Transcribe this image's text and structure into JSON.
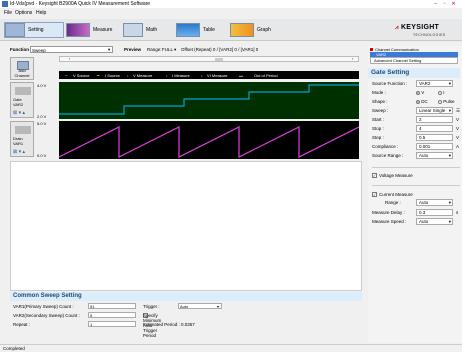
{
  "window": {
    "title": "Id-Vds(pvd - Keysight B2900A Quick IV Measurement Software"
  },
  "menu": {
    "items": [
      "File",
      "Options",
      "Help"
    ]
  },
  "toolbar": {
    "buttons": [
      {
        "label": "Setting",
        "active": true
      },
      {
        "label": "Measure",
        "active": false
      },
      {
        "label": "Math",
        "active": false
      },
      {
        "label": "Table",
        "active": false
      },
      {
        "label": "Graph",
        "active": false
      }
    ],
    "logo": "KEYSIGHT",
    "logo_sub": "TECHNOLOGIES"
  },
  "function_bar": {
    "function_label": "Function",
    "function_value": "Sweep",
    "preview_label": "Preview",
    "range_label": "Range:",
    "range_value": "FULL",
    "offset_text": "Offset (Repeat) 0 / [VAR2] 0 / [VAR1] 0"
  },
  "left": {
    "add_channel": "Add Channel"
  },
  "legend": {
    "items": [
      "V Source",
      "I Source",
      "V Measure",
      "I Measure",
      "VI Measure",
      "Out of Period"
    ],
    "colors": [
      "#00a0d8",
      "#e8e800",
      "#aaaaaa",
      "#aaaaaa",
      "#aaaaaa",
      "#ffffff"
    ]
  },
  "channels": [
    {
      "name": "Gate",
      "var": "VAR2",
      "ymax": "4.0 V",
      "ymin": "2.0 V",
      "bg": "#003000",
      "trace": "#00a0d8"
    },
    {
      "name": "Drain",
      "var": "VAR1",
      "ymax": "5.0 V",
      "ymin": "0.0 V",
      "bg": "#000000",
      "trace": "#e040e0"
    }
  ],
  "right_tabs": {
    "items": [
      "Channel Communication",
      "VAR2",
      "Advanced Channel Setting"
    ]
  },
  "gate_setting": {
    "header": "Gate Setting",
    "rows": [
      {
        "key": "Source Function :",
        "value": "VAR2",
        "unit": ""
      },
      {
        "key": "Mode :",
        "value": "",
        "unit": ""
      },
      {
        "key": "Shape :",
        "value": "",
        "unit": ""
      },
      {
        "key": "Sweep :",
        "value": "Linear Single",
        "unit": ""
      },
      {
        "key": "Start :",
        "value": "2",
        "unit": "V"
      },
      {
        "key": "Stop :",
        "value": "4",
        "unit": "V"
      },
      {
        "key": "Step :",
        "value": "0.5",
        "unit": "V"
      },
      {
        "key": "Compliance :",
        "value": "0.001",
        "unit": "A"
      },
      {
        "key": "Source Range :",
        "value": "Auto",
        "unit": ""
      }
    ],
    "mode_options": [
      "V",
      "I"
    ],
    "shape_options": [
      "DC",
      "Pulse"
    ],
    "voltage_measure": "Voltage Measure",
    "current_measure": "Current Measure",
    "range_label": "Range :",
    "range_value": "Auto",
    "measure_delay_label": "Measure Delay :",
    "measure_delay_value": "0.3",
    "measure_delay_unit": "s",
    "measure_speed_label": "Measure Speed :",
    "measure_speed_value": "Auto"
  },
  "common_sweep": {
    "header": "Common Sweep Setting",
    "var1_label": "VAR1(Primary Sweep) Count :",
    "var1_value": "51",
    "var2_label": "VAR2(Secondary Sweep) Count :",
    "var2_value": "5",
    "repeat_label": "Repeat :",
    "repeat_value": "1",
    "trigger_label": "Trigger :",
    "trigger_value": "Auto",
    "specify_label": "Specify Minimum Auto Trigger Period",
    "estimated_label": "Estimated Period : 0.0357"
  },
  "status": "Completed"
}
